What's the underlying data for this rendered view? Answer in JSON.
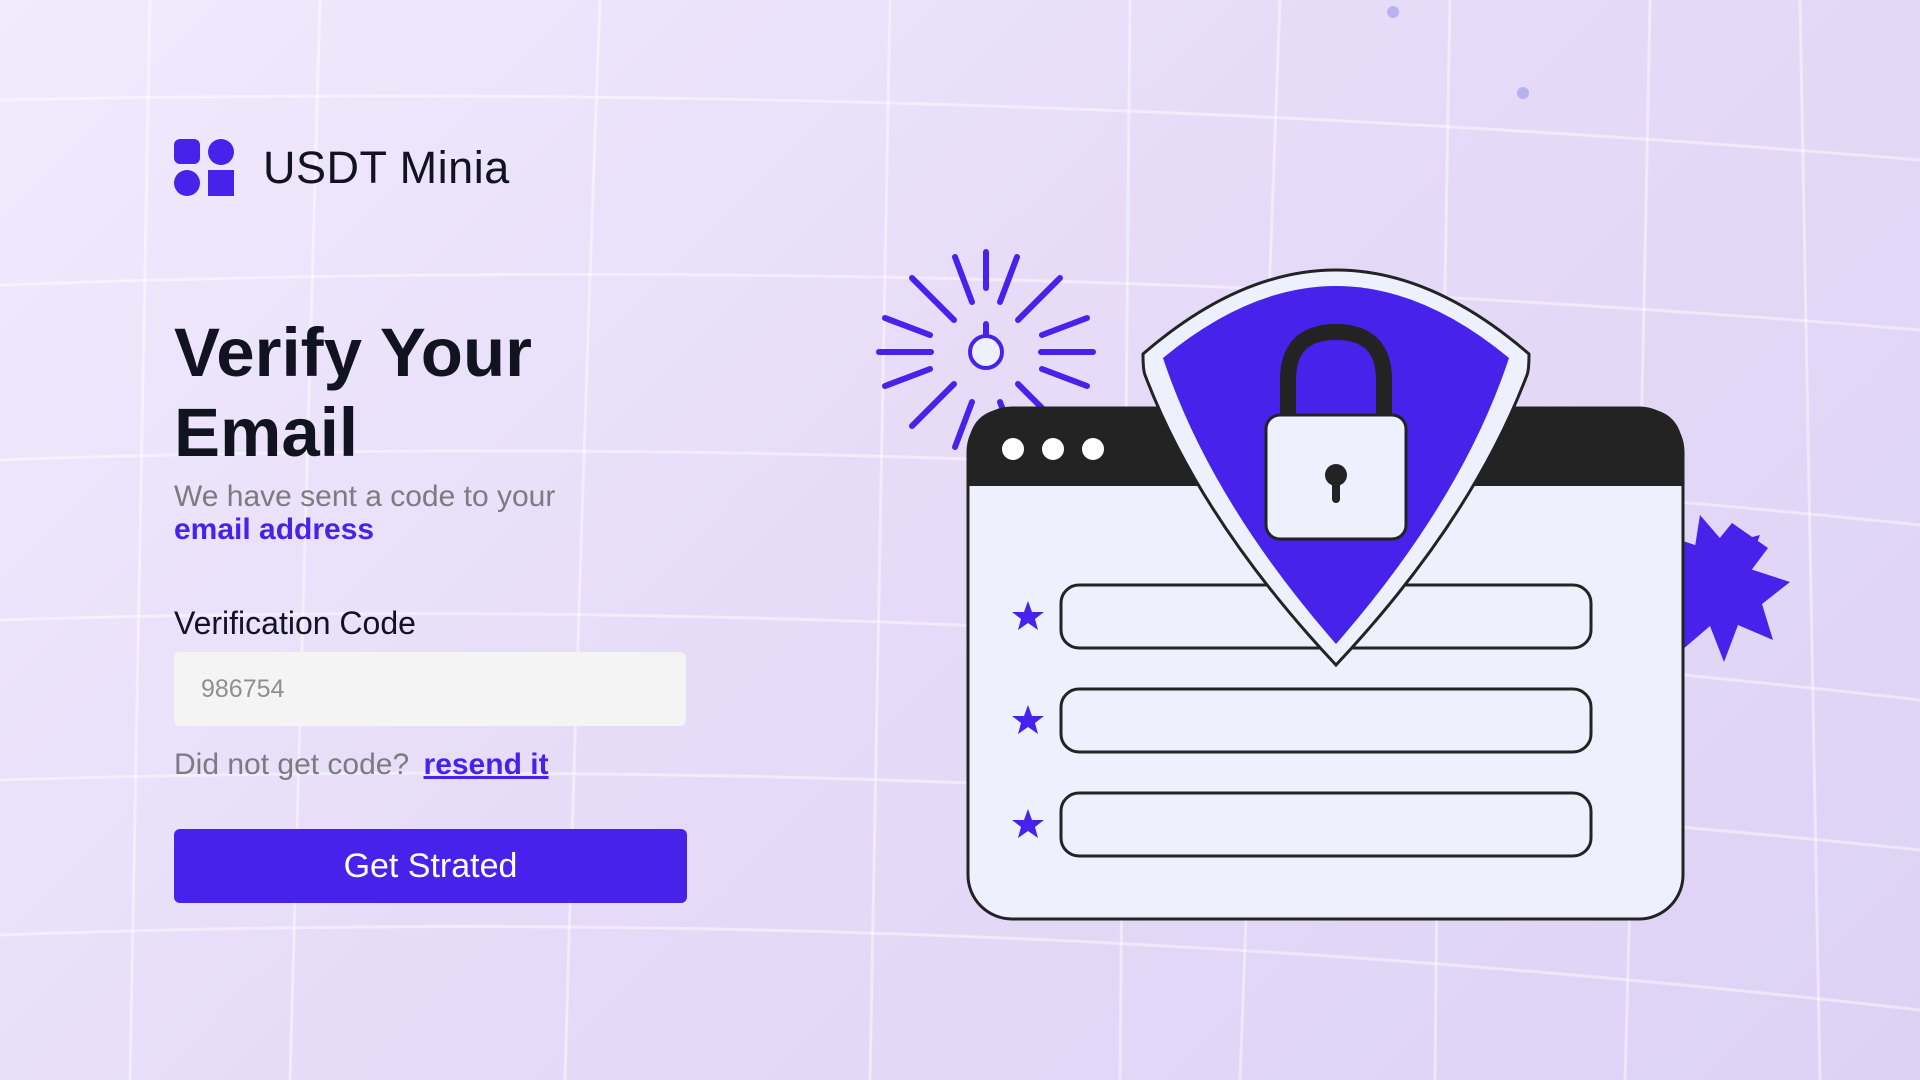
{
  "brand": {
    "name": "USDT Minia"
  },
  "heading": "Verify Your Email",
  "subtitle": {
    "text": "We have sent a code to your",
    "link": "email address"
  },
  "form": {
    "code_label": "Verification Code",
    "code_placeholder": "986754",
    "resend_prompt": "Did not get code?",
    "resend_link": "resend it",
    "submit_label": "Get Strated"
  },
  "colors": {
    "accent": "#4622EA",
    "text_dark": "#111320",
    "text_muted": "#7B7B82",
    "input_bg": "#F4F4F5",
    "background": "#E8DFF9",
    "illustration_dark": "#232323",
    "illustration_light": "#EEF0FE"
  },
  "illustration": {
    "icons": [
      "sunburst-icon",
      "browser-window-icon",
      "shield-icon",
      "padlock-icon",
      "star-icon",
      "starburst-badge-icon"
    ]
  }
}
